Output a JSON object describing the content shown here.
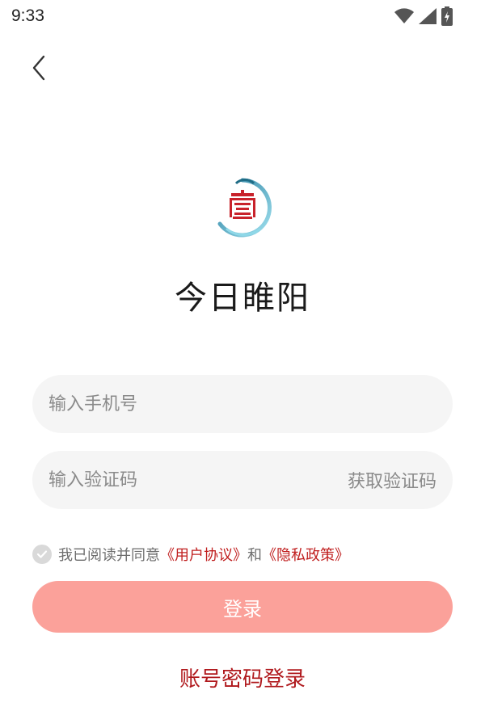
{
  "status_bar": {
    "time": "9:33",
    "icons": [
      "wifi-icon",
      "signal-icon",
      "battery-icon"
    ]
  },
  "header": {
    "back_icon": "chevron-left-icon"
  },
  "branding": {
    "title": "今日睢阳"
  },
  "form": {
    "phone_placeholder": "输入手机号",
    "phone_value": "",
    "code_placeholder": "输入验证码",
    "code_value": "",
    "get_code_label": "获取验证码"
  },
  "agreement": {
    "prefix": "我已阅读并同意",
    "user_agreement": "《用户协议》",
    "conjunction": "和",
    "privacy_policy": "《隐私政策》",
    "checked": false
  },
  "actions": {
    "login_label": "登录",
    "password_login_label": "账号密码登录"
  },
  "colors": {
    "accent_red": "#b0191d",
    "link_red": "#c01f1f",
    "login_button": "#fba19a",
    "field_bg": "#f5f5f5"
  }
}
